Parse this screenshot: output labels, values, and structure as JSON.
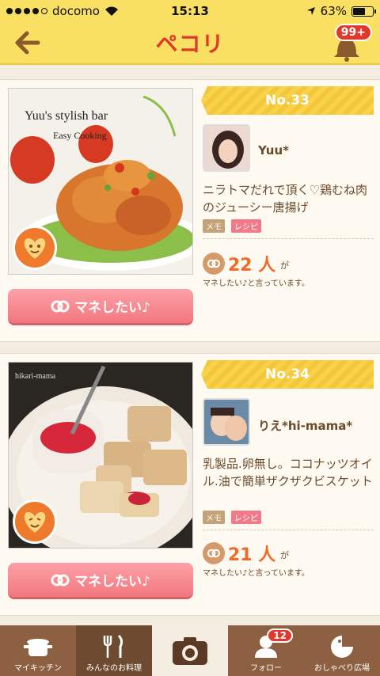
{
  "status": {
    "carrier": "docomo",
    "time": "15:13",
    "battery": "63%",
    "battery_fraction": 0.63
  },
  "header": {
    "logo": "ペコリ",
    "notifications": "99+"
  },
  "cards": [
    {
      "rank": "No.33",
      "user": "Yuu*",
      "title": "ニラトマだれで頂く♡鶏むね肉のジューシー唐揚げ",
      "tag_memo": "メモ",
      "tag_recipe": "レシピ",
      "count": "22 人",
      "ga": "が",
      "desc": "マネしたい♪と言っています。",
      "button": "マネしたい♪",
      "photo_caption1": "Yuu's stylish bar",
      "photo_caption2": "Easy Cooking"
    },
    {
      "rank": "No.34",
      "user": "りえ*hi-mama*",
      "title": "乳製品.卵無し。ココナッツオイル.油で簡単ザクザクビスケット",
      "tag_memo": "メモ",
      "tag_recipe": "レシピ",
      "count": "21 人",
      "ga": "が",
      "desc": "マネしたい♪と言っています。",
      "button": "マネしたい♪",
      "photo_caption1": "hikari-mama"
    }
  ],
  "tabs": [
    {
      "label": "マイキッチン",
      "icon": "pot-icon"
    },
    {
      "label": "みんなのお料理",
      "icon": "fork-knife-icon"
    },
    {
      "label": "",
      "icon": "camera-icon"
    },
    {
      "label": "フォロー",
      "icon": "follow-icon",
      "badge": "12"
    },
    {
      "label": "おしゃべり広場",
      "icon": "chat-icon"
    }
  ]
}
